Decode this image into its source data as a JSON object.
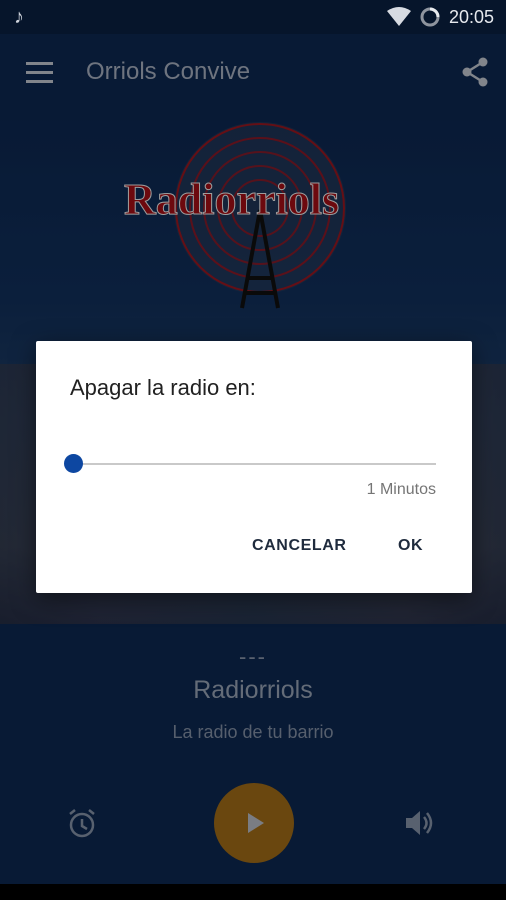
{
  "status_bar": {
    "time": "20:05",
    "icons": [
      "music-note-icon",
      "wifi-icon",
      "loading-icon"
    ]
  },
  "app_bar": {
    "title": "Orriols Convive",
    "icons": [
      "menu-icon",
      "share-icon"
    ]
  },
  "hero": {
    "logo_text": "Radiorriols"
  },
  "player": {
    "track_placeholder": "---",
    "station_name": "Radiorriols",
    "slogan": "La radio de tu barrio",
    "controls": [
      "alarm-icon",
      "play-icon",
      "volume-icon"
    ]
  },
  "dialog": {
    "title": "Apagar la radio en:",
    "slider_level": 0.0,
    "value_label": "1 Minutos",
    "cancel_label": "CANCELAR",
    "ok_label": "OK"
  },
  "colors": {
    "primary": "#0d2852",
    "accent": "#0d47a1",
    "play": "#a36e18",
    "logo_red": "#b01218"
  }
}
